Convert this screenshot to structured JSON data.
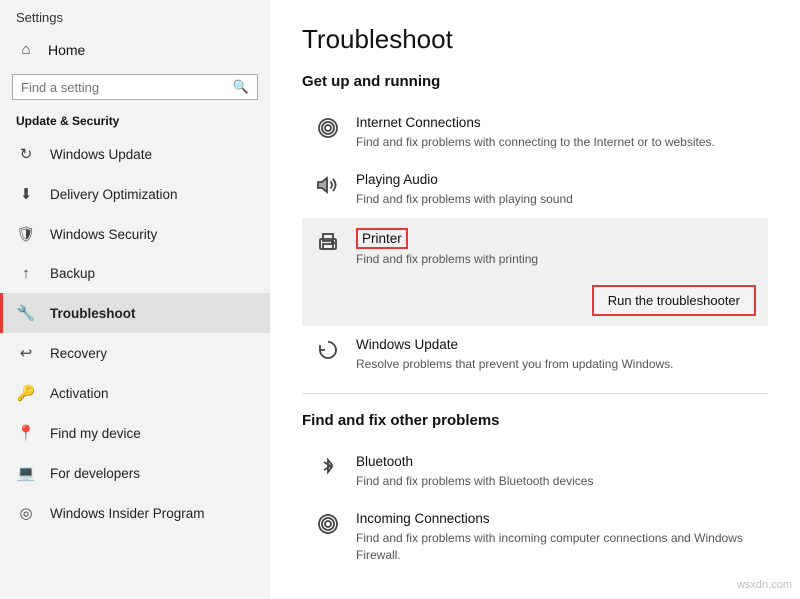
{
  "sidebar": {
    "title": "Settings",
    "home_label": "Home",
    "search_placeholder": "Find a setting",
    "section_label": "Update & Security",
    "items": [
      {
        "id": "windows-update",
        "label": "Windows Update",
        "icon": "↻"
      },
      {
        "id": "delivery-optimization",
        "label": "Delivery Optimization",
        "icon": "⬇"
      },
      {
        "id": "windows-security",
        "label": "Windows Security",
        "icon": "🛡"
      },
      {
        "id": "backup",
        "label": "Backup",
        "icon": "↑"
      },
      {
        "id": "troubleshoot",
        "label": "Troubleshoot",
        "icon": "🔧",
        "active": true
      },
      {
        "id": "recovery",
        "label": "Recovery",
        "icon": "↩"
      },
      {
        "id": "activation",
        "label": "Activation",
        "icon": "🔑"
      },
      {
        "id": "find-my-device",
        "label": "Find my device",
        "icon": "📍"
      },
      {
        "id": "for-developers",
        "label": "For developers",
        "icon": "💻"
      },
      {
        "id": "windows-insider",
        "label": "Windows Insider Program",
        "icon": "◎"
      }
    ]
  },
  "main": {
    "title": "Troubleshoot",
    "section1": "Get up and running",
    "items1": [
      {
        "id": "internet-connections",
        "icon": "((•))",
        "name": "Internet Connections",
        "desc": "Find and fix problems with connecting to the Internet or to websites.",
        "highlighted": false
      },
      {
        "id": "playing-audio",
        "icon": "🔊",
        "name": "Playing Audio",
        "desc": "Find and fix problems with playing sound",
        "highlighted": false
      },
      {
        "id": "printer",
        "icon": "🖨",
        "name": "Printer",
        "desc": "Find and fix problems with printing",
        "highlighted": true,
        "boxed_name": true
      },
      {
        "id": "windows-update",
        "icon": "↻",
        "name": "Windows Update",
        "desc": "Resolve problems that prevent you from updating Windows.",
        "highlighted": false
      }
    ],
    "run_btn_label": "Run the troubleshooter",
    "section2": "Find and fix other problems",
    "items2": [
      {
        "id": "bluetooth",
        "icon": "ᛒ",
        "name": "Bluetooth",
        "desc": "Find and fix problems with Bluetooth devices",
        "highlighted": false
      },
      {
        "id": "incoming-connections",
        "icon": "((•))",
        "name": "Incoming Connections",
        "desc": "Find and fix problems with incoming computer connections and Windows Firewall.",
        "highlighted": false
      }
    ]
  },
  "watermark": "wsxdn.com"
}
